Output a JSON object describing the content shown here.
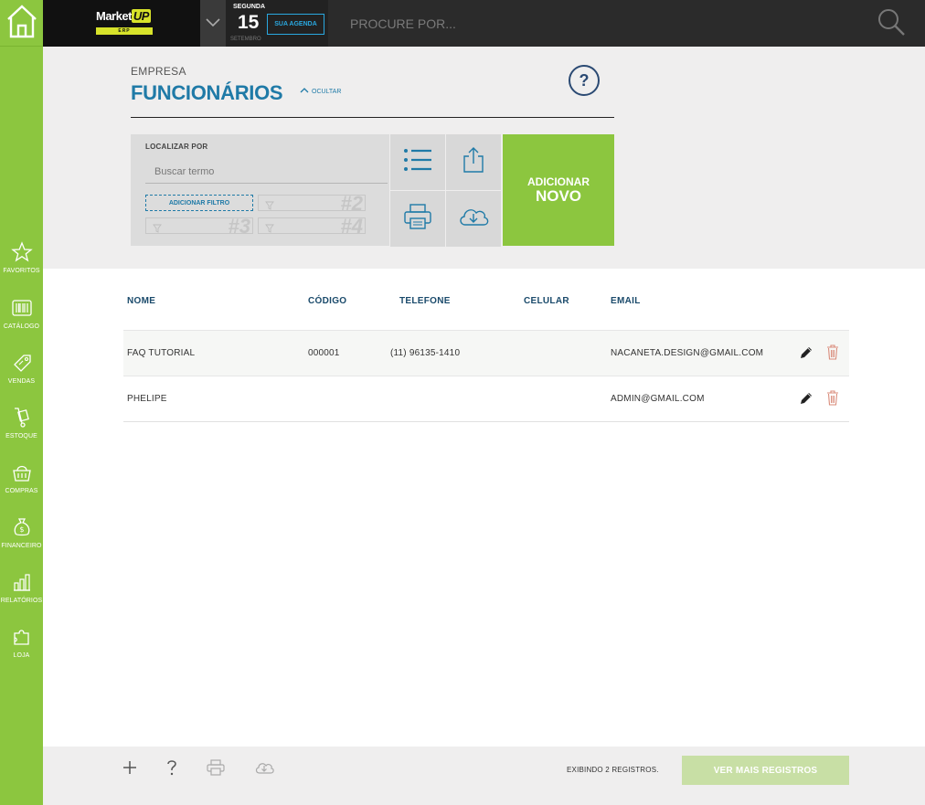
{
  "topbar": {
    "logo_text": "Market",
    "logo_up": "UP",
    "logo_erp": "ERP",
    "date_weekday": "SEGUNDA",
    "date_day": "15",
    "date_month": "SETEMBRO",
    "agenda_label": "SUA AGENDA",
    "search_placeholder": "PROCURE POR..."
  },
  "sidebar": {
    "items": [
      {
        "label": "FAVORITOS",
        "icon": "star-icon"
      },
      {
        "label": "CATÁLOGO",
        "icon": "barcode-icon"
      },
      {
        "label": "VENDAS",
        "icon": "tag-icon"
      },
      {
        "label": "ESTOQUE",
        "icon": "hand-truck-icon"
      },
      {
        "label": "COMPRAS",
        "icon": "basket-icon"
      },
      {
        "label": "FINANCEIRO",
        "icon": "money-bag-icon"
      },
      {
        "label": "RELATÓRIOS",
        "icon": "bar-chart-icon"
      },
      {
        "label": "LOJA",
        "icon": "puzzle-icon"
      }
    ]
  },
  "header": {
    "section": "EMPRESA",
    "title": "FUNCIONÁRIOS",
    "hide_label": "OCULTAR",
    "help": "?"
  },
  "filter": {
    "label": "LOCALIZAR POR",
    "term_placeholder": "Buscar termo",
    "add_filter_label": "ADICIONAR FILTRO",
    "slots": [
      "#2",
      "#3",
      "#4"
    ]
  },
  "actions": {
    "add_line1": "ADICIONAR",
    "add_line2": "NOVO"
  },
  "table": {
    "columns": [
      "NOME",
      "CÓDIGO",
      "TELEFONE",
      "CELULAR",
      "EMAIL"
    ],
    "rows": [
      {
        "nome": "FAQ TUTORIAL",
        "codigo": "000001",
        "telefone": "(11) 96135-1410",
        "celular": "",
        "email": "NACANETA.DESIGN@GMAIL.COM"
      },
      {
        "nome": "PHELIPE",
        "codigo": "",
        "telefone": "",
        "celular": "",
        "email": "ADMIN@GMAIL.COM"
      }
    ]
  },
  "footer": {
    "showing": "EXIBINDO 2 REGISTROS.",
    "more_label": "VER MAIS REGISTROS"
  },
  "colors": {
    "brand_green": "#8cc63f",
    "title_blue": "#1f7aa7",
    "topbar": "#2b2b2b",
    "delete_red": "#d98b7a"
  }
}
